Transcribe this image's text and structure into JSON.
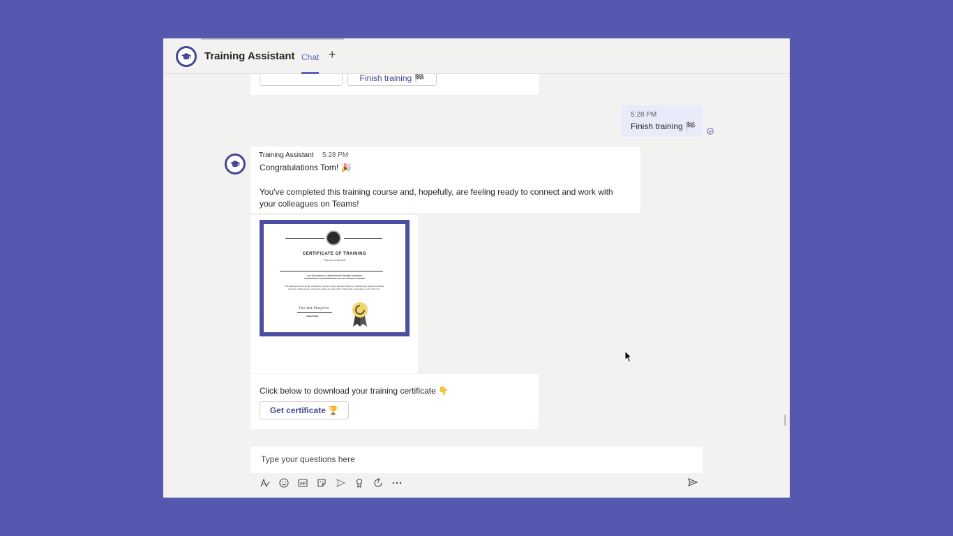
{
  "header": {
    "app_title": "Training Assistant",
    "tab_chat": "Chat",
    "add_tab": "+"
  },
  "previous_card": {
    "finish_button": "Finish training 🏁"
  },
  "user_message": {
    "time": "5:28 PM",
    "text": "Finish training 🏁"
  },
  "bot_message": {
    "sender": "Training Assistant",
    "time": "5:28 PM",
    "greeting": "Congratulations Tom! 🎉",
    "body": "You've completed this training course and, hopefully, are feeling ready to connect and work with your colleagues on Teams!"
  },
  "certificate": {
    "title": "CERTIFICATE OF TRAINING",
    "subtitle": "This is to certify that",
    "completed_line1": "HAS SUCCESSFULLY COMPLETED THE TRAINING ASSISTANT",
    "completed_line2": "FOR MICROSOFT TEAMS PROGRAM, BUILT BY THE BOT PLATFORM",
    "description": "This training tool acts as an introductory course to using Microsoft Teams by outlining key features including channels, writing posts, joining and setting up video calls, sharing files, using apps, and much more.",
    "signature_script": "The Bot Platform",
    "signature_label": "SIGNATURE"
  },
  "download_card": {
    "text": "Click below to download your training certificate 👇",
    "button": "Get certificate 🏆"
  },
  "composer": {
    "placeholder": "Type your questions here"
  },
  "colors": {
    "background": "#5558af",
    "accent": "#5b5fc7",
    "brand_dark": "#444791"
  },
  "icons": [
    "format-icon",
    "emoji-icon",
    "gif-icon",
    "sticker-icon",
    "meet-icon",
    "praise-icon",
    "loop-icon",
    "more-icon",
    "send-icon",
    "read-receipt-icon",
    "graduation-cap-icon"
  ]
}
